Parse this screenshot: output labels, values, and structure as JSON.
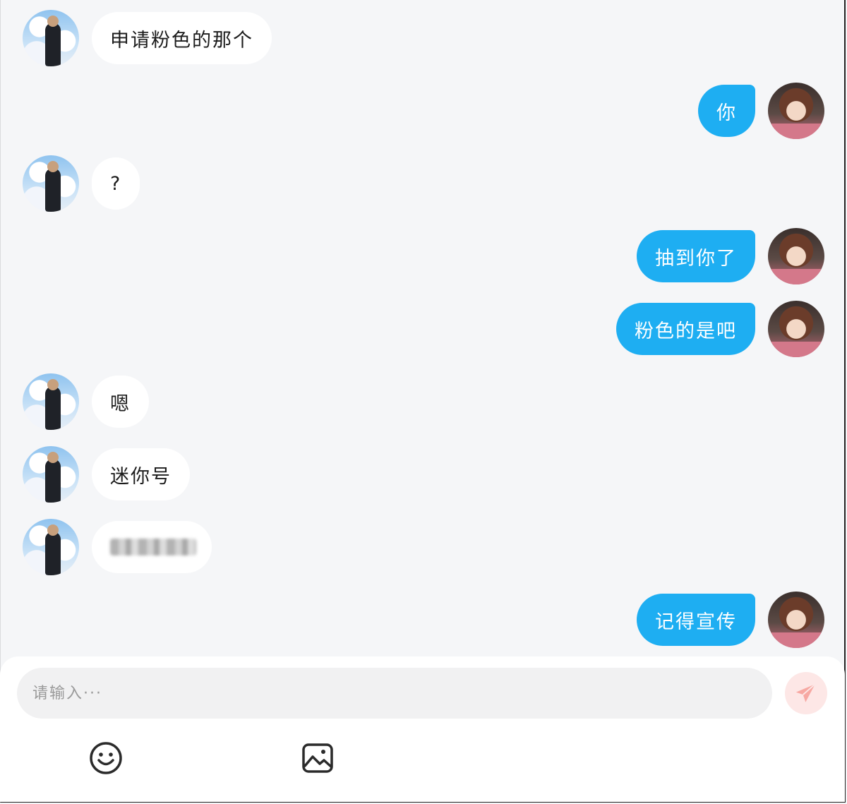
{
  "messages": [
    {
      "side": "in",
      "text": "申请粉色的那个"
    },
    {
      "side": "out",
      "text": "你"
    },
    {
      "side": "in",
      "text": "?"
    },
    {
      "side": "out",
      "text": "抽到你了"
    },
    {
      "side": "out",
      "text": "粉色的是吧"
    },
    {
      "side": "in",
      "text": "嗯"
    },
    {
      "side": "in",
      "text": "迷你号"
    },
    {
      "side": "in",
      "text": "",
      "blurred": true
    },
    {
      "side": "out",
      "text": "记得宣传"
    }
  ],
  "composer": {
    "placeholder": "请输入···",
    "send_icon": "paper-plane-icon",
    "emoji_icon": "smiley-face-icon",
    "image_icon": "image-icon"
  },
  "colors": {
    "background": "#f5f6f8",
    "outgoing_bubble": "#1eaef2",
    "incoming_bubble": "#ffffff",
    "send_button": "#fde7e6",
    "send_icon": "#f7a8a2"
  }
}
